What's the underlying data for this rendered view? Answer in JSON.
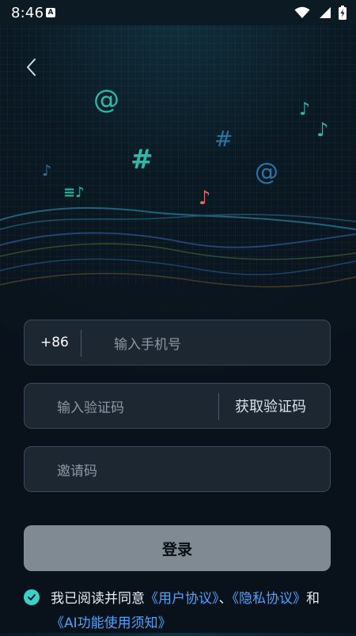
{
  "status_bar": {
    "time": "8:46",
    "notification_badge": "A",
    "icons": [
      "wifi-icon",
      "signal-icon",
      "battery-charging-icon"
    ]
  },
  "nav": {
    "back_icon": "chevron-left-icon"
  },
  "hero": {
    "decorations": [
      "@",
      "#",
      "#",
      "@",
      "♪",
      "♪",
      "♪",
      "♪",
      "≡♪"
    ],
    "colors": {
      "teal": "#2bb9a8",
      "blue": "#2a74a8",
      "coral": "#e0705e"
    }
  },
  "form": {
    "phone": {
      "country_code": "+86",
      "placeholder": "输入手机号"
    },
    "code": {
      "placeholder": "输入验证码",
      "get_code_label": "获取验证码"
    },
    "invite": {
      "placeholder": "邀请码"
    },
    "login_label": "登录"
  },
  "agreement": {
    "checked": true,
    "prefix": "我已阅读并同意",
    "user_agreement": "《用户协议》",
    "separator": "、",
    "privacy_policy": "《隐私协议》",
    "conjunction": "和",
    "ai_notice": "《AI功能使用须知》"
  }
}
